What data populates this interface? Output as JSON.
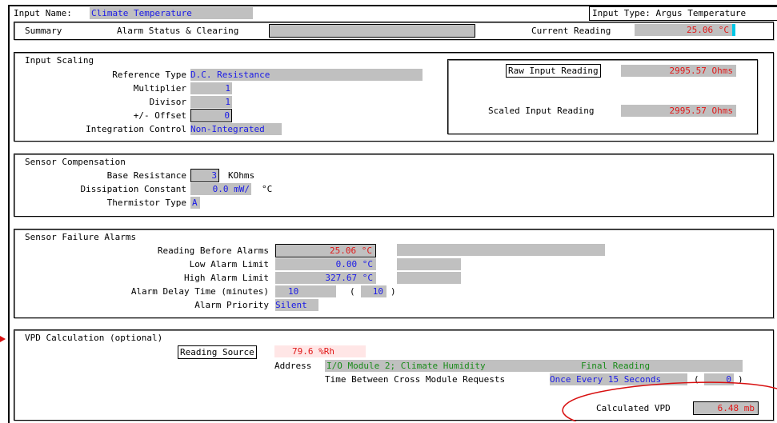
{
  "header": {
    "input_name_label": "Input Name:",
    "input_name_value": "Climate Temperature",
    "input_type_label": "Input Type:",
    "input_type_value": "Argus Temperature"
  },
  "summary_bar": {
    "summary_label": "Summary",
    "alarm_status_label": "Alarm Status & Clearing",
    "alarm_status_value": "",
    "current_reading_label": "Current Reading",
    "current_reading_value": "25.06 °C"
  },
  "input_scaling": {
    "title": "Input Scaling",
    "reference_type_label": "Reference Type",
    "reference_type_value": "D.C. Resistance",
    "multiplier_label": "Multiplier",
    "multiplier_value": "1",
    "divisor_label": "Divisor",
    "divisor_value": "1",
    "offset_label": "+/- Offset",
    "offset_value": "0",
    "integration_label": "Integration Control",
    "integration_value": "Non-Integrated",
    "raw_reading_label": "Raw Input Reading",
    "raw_reading_value": "2995.57 Ohms",
    "scaled_reading_label": "Scaled Input Reading",
    "scaled_reading_value": "2995.57 Ohms"
  },
  "sensor_compensation": {
    "title": "Sensor Compensation",
    "base_resistance_label": "Base Resistance",
    "base_resistance_value": "3",
    "base_resistance_unit": "KOhms",
    "dissipation_label": "Dissipation Constant",
    "dissipation_value": "0.0 mW/",
    "dissipation_unit": "°C",
    "thermistor_label": "Thermistor Type",
    "thermistor_value": "A"
  },
  "sensor_failure": {
    "title": "Sensor Failure Alarms",
    "reading_before_label": "Reading Before Alarms",
    "reading_before_value": "25.06 °C",
    "low_limit_label": "Low Alarm Limit",
    "low_limit_value": "0.00 °C",
    "high_limit_label": "High Alarm Limit",
    "high_limit_value": "327.67 °C",
    "delay_label": "Alarm Delay Time (minutes)",
    "delay_value": "10",
    "delay_paren_open": "(",
    "delay_current": "10",
    "delay_paren_close": ")",
    "priority_label": "Alarm Priority",
    "priority_value": "Silent"
  },
  "vpd": {
    "title": "VPD Calculation (optional)",
    "reading_source_label": "Reading Source",
    "reading_source_value": "79.6 %Rh",
    "address_label": "Address",
    "address_value": "I/O Module 2; Climate Humidity",
    "final_reading": "Final Reading",
    "time_between_label": "Time Between Cross Module Requests",
    "time_between_value": "Once Every 15 Seconds",
    "time_paren_open": "(",
    "time_current": "0",
    "time_paren_close": ")",
    "calculated_label": "Calculated VPD",
    "calculated_value": "6.48 mb"
  },
  "colors": {
    "value_blue": "#1a1ae6",
    "value_red": "#e01818",
    "value_green": "#1a8a1a",
    "field_gray": "#c0c0c0",
    "annotation_red": "#d81010"
  }
}
